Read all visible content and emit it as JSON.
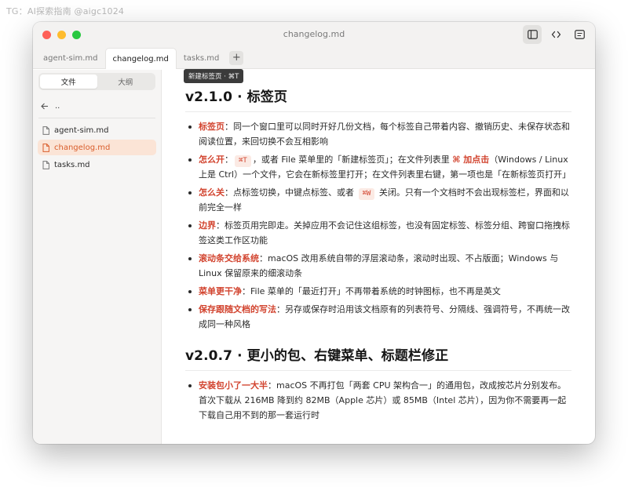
{
  "watermark": "TG：AI探索指南 @aigc1024",
  "window": {
    "title": "changelog.md"
  },
  "colors": {
    "accent": "#d2442f",
    "sidebar_active_bg": "#fbe4d6",
    "sidebar_active_text": "#d95d2b"
  },
  "toolbar": {
    "icons": [
      "sidebar-toggle-icon",
      "code-view-icon",
      "outline-panel-icon"
    ]
  },
  "tabs": [
    {
      "label": "agent-sim.md",
      "active": false
    },
    {
      "label": "changelog.md",
      "active": true
    },
    {
      "label": "tasks.md",
      "active": false
    }
  ],
  "tab_add_label": "+",
  "tooltip": "新建标签页 · ⌘T",
  "sidebar": {
    "segments": [
      {
        "label": "文件",
        "active": true
      },
      {
        "label": "大纲",
        "active": false
      }
    ],
    "up_label": "..",
    "files": [
      {
        "label": "agent-sim.md",
        "active": false
      },
      {
        "label": "changelog.md",
        "active": true
      },
      {
        "label": "tasks.md",
        "active": false
      }
    ]
  },
  "doc": {
    "sections": [
      {
        "heading": "v2.1.0 · 标签页",
        "items": [
          [
            {
              "t": "kw",
              "v": "标签页"
            },
            {
              "t": "text",
              "v": "：同一个窗口里可以同时开好几份文档，每个标签自己带着内容、撤销历史、未保存状态和阅读位置，来回切换不会互相影响"
            }
          ],
          [
            {
              "t": "kw",
              "v": "怎么开"
            },
            {
              "t": "text",
              "v": "："
            },
            {
              "t": "kbd",
              "v": "⌘T"
            },
            {
              "t": "text",
              "v": "，或者 File 菜单里的「新建标签页」；在文件列表里 "
            },
            {
              "t": "kw",
              "v": "⌘ 加点击"
            },
            {
              "t": "text",
              "v": "（Windows / Linux 上是 Ctrl）一个文件，它会在新标签里打开；在文件列表里右键，第一项也是「在新标签页打开」"
            }
          ],
          [
            {
              "t": "kw",
              "v": "怎么关"
            },
            {
              "t": "text",
              "v": "：点标签切换，中键点标签、或者 "
            },
            {
              "t": "kbd",
              "v": "⌘W"
            },
            {
              "t": "text",
              "v": " 关闭。只有一个文档时不会出现标签栏，界面和以前完全一样"
            }
          ],
          [
            {
              "t": "kw",
              "v": "边界"
            },
            {
              "t": "text",
              "v": "：标签页用完即走。关掉应用不会记住这组标签，也没有固定标签、标签分组、跨窗口拖拽标签这类工作区功能"
            }
          ],
          [
            {
              "t": "kw",
              "v": "滚动条交给系统"
            },
            {
              "t": "text",
              "v": "：macOS 改用系统自带的浮层滚动条，滚动时出现、不占版面；Windows 与 Linux 保留原来的细滚动条"
            }
          ],
          [
            {
              "t": "kw",
              "v": "菜单更干净"
            },
            {
              "t": "text",
              "v": "：File 菜单的「最近打开」不再带着系统的时钟图标，也不再是英文"
            }
          ],
          [
            {
              "t": "kw",
              "v": "保存跟随文档的写法"
            },
            {
              "t": "text",
              "v": "：另存或保存时沿用该文档原有的列表符号、分隔线、强调符号，不再统一改成同一种风格"
            }
          ]
        ]
      },
      {
        "heading": "v2.0.7 · 更小的包、右键菜单、标题栏修正",
        "items": [
          [
            {
              "t": "kw",
              "v": "安装包小了一大半"
            },
            {
              "t": "text",
              "v": "：macOS 不再打包「两套 CPU 架构合一」的通用包，改成按芯片分别发布。首次下载从 216MB 降到约 82MB（Apple 芯片）或 85MB（Intel 芯片），因为你不需要再一起下载自己用不到的那一套运行时"
            }
          ]
        ]
      }
    ]
  }
}
